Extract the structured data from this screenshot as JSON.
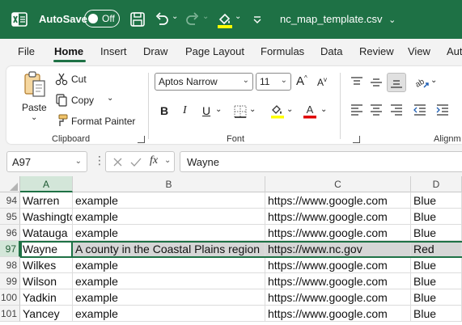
{
  "titlebar": {
    "autosave_label": "AutoSave",
    "autosave_state": "Off",
    "filename": "nc_map_template.csv",
    "filename_chevron": "⌄",
    "brand_color": "#1e7145"
  },
  "tabs": [
    {
      "label": "File"
    },
    {
      "label": "Home"
    },
    {
      "label": "Insert"
    },
    {
      "label": "Draw"
    },
    {
      "label": "Page Layout"
    },
    {
      "label": "Formulas"
    },
    {
      "label": "Data"
    },
    {
      "label": "Review"
    },
    {
      "label": "View"
    },
    {
      "label": "Aut"
    }
  ],
  "active_tab": "Home",
  "ribbon": {
    "clipboard": {
      "paste_label": "Paste",
      "cut_label": "Cut",
      "copy_label": "Copy",
      "format_painter_label": "Format Painter",
      "group_label": "Clipboard"
    },
    "font": {
      "font_name": "Aptos Narrow",
      "font_size": "11",
      "bold_label": "B",
      "italic_label": "I",
      "underline_label": "U",
      "grow_label": "A",
      "shrink_label": "A",
      "font_color_label": "A",
      "group_label": "Font",
      "highlight_color": "#ffff00",
      "font_color": "#e00000"
    },
    "alignment": {
      "group_label": "Alignm",
      "orientation_label": "ab"
    }
  },
  "formula_bar": {
    "name_box": "A97",
    "fx_label": "fx",
    "formula_value": "Wayne"
  },
  "grid": {
    "columns": [
      "A",
      "B",
      "C",
      "D"
    ],
    "selected_column": "A",
    "rows": [
      {
        "num": "94",
        "cells": [
          "Warren",
          "example",
          "https://www.google.com",
          "Blue"
        ]
      },
      {
        "num": "95",
        "cells": [
          "Washington",
          "example",
          "https://www.google.com",
          "Blue"
        ]
      },
      {
        "num": "96",
        "cells": [
          "Watauga",
          "example",
          "https://www.google.com",
          "Blue"
        ]
      },
      {
        "num": "97",
        "cells": [
          "Wayne",
          "A county in the Coastal Plains region",
          "https://www.nc.gov",
          "Red"
        ],
        "selected": true
      },
      {
        "num": "98",
        "cells": [
          "Wilkes",
          "example",
          "https://www.google.com",
          "Blue"
        ]
      },
      {
        "num": "99",
        "cells": [
          "Wilson",
          "example",
          "https://www.google.com",
          "Blue"
        ]
      },
      {
        "num": "100",
        "cells": [
          "Yadkin",
          "example",
          "https://www.google.com",
          "Blue"
        ]
      },
      {
        "num": "101",
        "cells": [
          "Yancey",
          "example",
          "https://www.google.com",
          "Blue"
        ]
      }
    ]
  }
}
